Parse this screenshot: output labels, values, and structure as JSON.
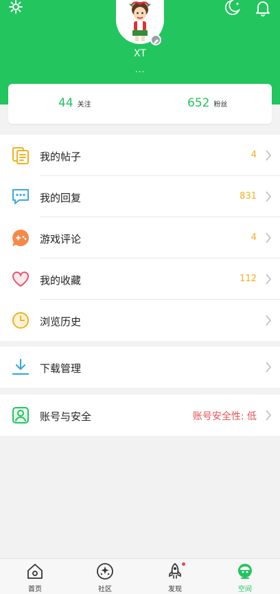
{
  "profile": {
    "username": "XT",
    "bio": "..."
  },
  "stats": {
    "following": {
      "count": "44",
      "label": "关注"
    },
    "followers": {
      "count": "652",
      "label": "粉丝"
    }
  },
  "menu": {
    "posts": {
      "label": "我的帖子",
      "value": "4"
    },
    "replies": {
      "label": "我的回复",
      "value": "831"
    },
    "game_reviews": {
      "label": "游戏评论",
      "value": "4"
    },
    "favorites": {
      "label": "我的收藏",
      "value": "112"
    },
    "history": {
      "label": "浏览历史"
    },
    "downloads": {
      "label": "下载管理"
    },
    "account": {
      "label": "账号与安全",
      "value": "账号安全性: 低"
    }
  },
  "tabs": [
    {
      "label": "首页",
      "icon": "home-icon"
    },
    {
      "label": "社区",
      "icon": "community-icon"
    },
    {
      "label": "发现",
      "icon": "rocket-icon",
      "badge_dot": true
    },
    {
      "label": "空间",
      "icon": "robot-face-icon",
      "active": true
    }
  ],
  "colors": {
    "brand": "#22c55e",
    "count_yellow": "#f2b01e",
    "warn_red": "#e55353"
  }
}
